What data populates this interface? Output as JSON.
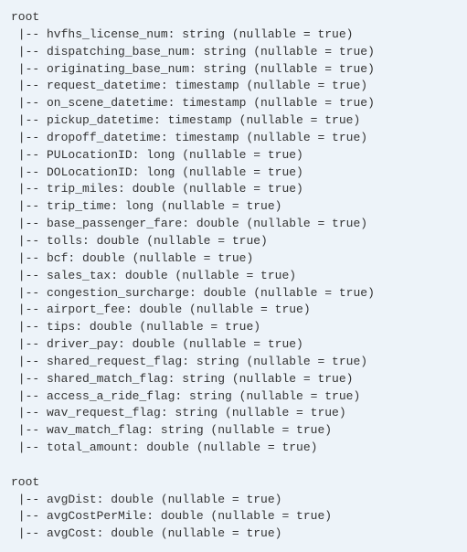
{
  "schemas": [
    {
      "label": "root",
      "fields": [
        {
          "name": "hvfhs_license_num",
          "type": "string",
          "nullable": true
        },
        {
          "name": "dispatching_base_num",
          "type": "string",
          "nullable": true
        },
        {
          "name": "originating_base_num",
          "type": "string",
          "nullable": true
        },
        {
          "name": "request_datetime",
          "type": "timestamp",
          "nullable": true
        },
        {
          "name": "on_scene_datetime",
          "type": "timestamp",
          "nullable": true
        },
        {
          "name": "pickup_datetime",
          "type": "timestamp",
          "nullable": true
        },
        {
          "name": "dropoff_datetime",
          "type": "timestamp",
          "nullable": true
        },
        {
          "name": "PULocationID",
          "type": "long",
          "nullable": true
        },
        {
          "name": "DOLocationID",
          "type": "long",
          "nullable": true
        },
        {
          "name": "trip_miles",
          "type": "double",
          "nullable": true
        },
        {
          "name": "trip_time",
          "type": "long",
          "nullable": true
        },
        {
          "name": "base_passenger_fare",
          "type": "double",
          "nullable": true
        },
        {
          "name": "tolls",
          "type": "double",
          "nullable": true
        },
        {
          "name": "bcf",
          "type": "double",
          "nullable": true
        },
        {
          "name": "sales_tax",
          "type": "double",
          "nullable": true
        },
        {
          "name": "congestion_surcharge",
          "type": "double",
          "nullable": true
        },
        {
          "name": "airport_fee",
          "type": "double",
          "nullable": true
        },
        {
          "name": "tips",
          "type": "double",
          "nullable": true
        },
        {
          "name": "driver_pay",
          "type": "double",
          "nullable": true
        },
        {
          "name": "shared_request_flag",
          "type": "string",
          "nullable": true
        },
        {
          "name": "shared_match_flag",
          "type": "string",
          "nullable": true
        },
        {
          "name": "access_a_ride_flag",
          "type": "string",
          "nullable": true
        },
        {
          "name": "wav_request_flag",
          "type": "string",
          "nullable": true
        },
        {
          "name": "wav_match_flag",
          "type": "string",
          "nullable": true
        },
        {
          "name": "total_amount",
          "type": "double",
          "nullable": true
        }
      ]
    },
    {
      "label": "root",
      "fields": [
        {
          "name": "avgDist",
          "type": "double",
          "nullable": true
        },
        {
          "name": "avgCostPerMile",
          "type": "double",
          "nullable": true
        },
        {
          "name": "avgCost",
          "type": "double",
          "nullable": true
        }
      ]
    }
  ]
}
